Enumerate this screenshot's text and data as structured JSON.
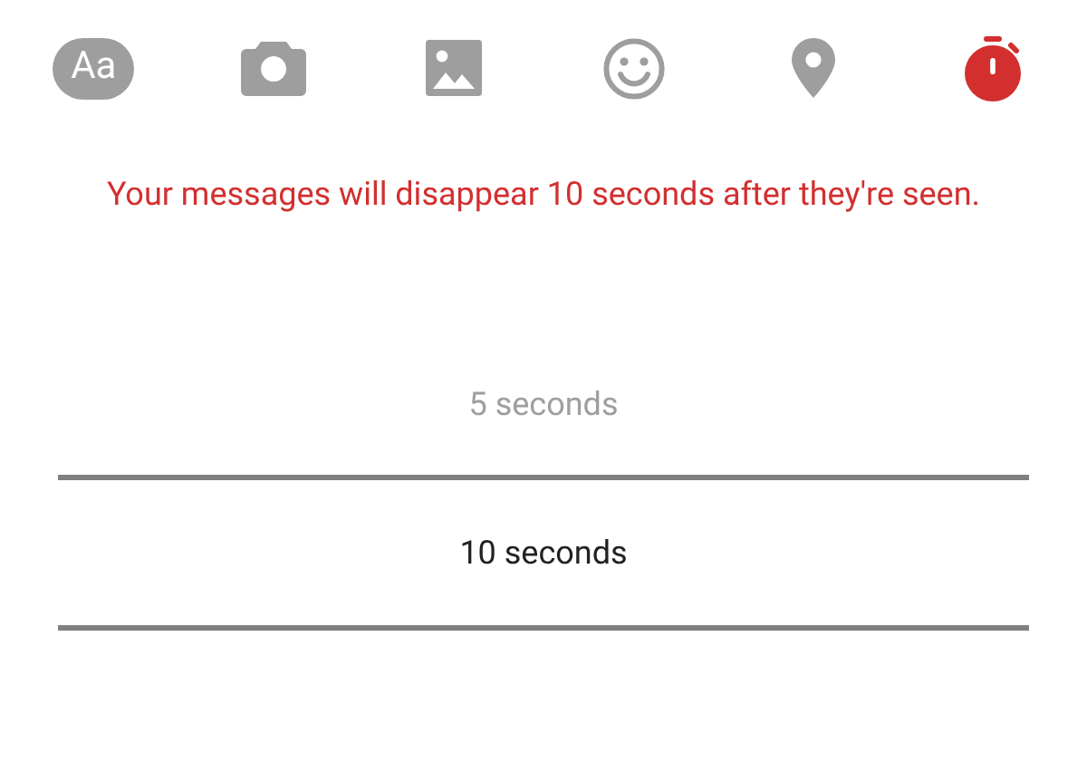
{
  "toolbar": [
    {
      "kind": "text",
      "label": "Aa",
      "selected": false
    },
    {
      "kind": "camera",
      "selected": false
    },
    {
      "kind": "image",
      "selected": false
    },
    {
      "kind": "emoji",
      "selected": false
    },
    {
      "kind": "location",
      "selected": false
    },
    {
      "kind": "timer",
      "selected": true
    }
  ],
  "notice": "Your messages will disappear 10 seconds after they're seen.",
  "picker": [
    {
      "label": "5 seconds",
      "selected": false
    },
    {
      "label": "10 seconds",
      "selected": true
    }
  ]
}
